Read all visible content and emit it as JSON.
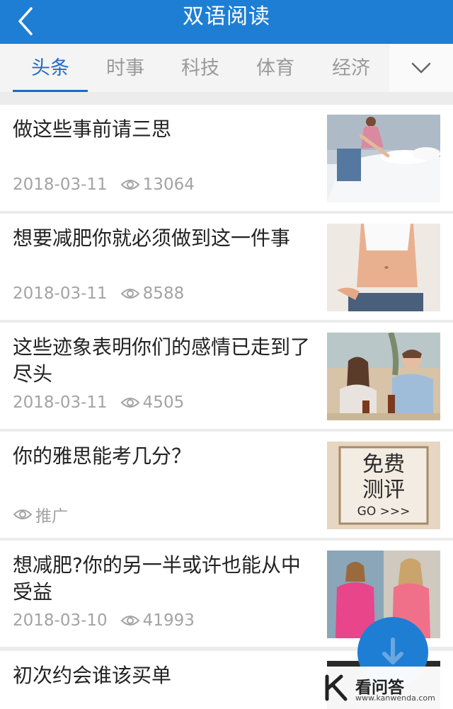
{
  "header": {
    "title": "双语阅读",
    "back_icon": "chevron-left-icon"
  },
  "tabs": [
    {
      "label": "头条",
      "active": true
    },
    {
      "label": "时事",
      "active": false
    },
    {
      "label": "科技",
      "active": false
    },
    {
      "label": "体育",
      "active": false
    },
    {
      "label": "经济",
      "active": false
    }
  ],
  "tabs_more_icon": "chevron-down-icon",
  "articles": [
    {
      "title": "做这些事前请三思",
      "date": "2018-03-11",
      "views": "13064",
      "thumb": "woman-making-bed"
    },
    {
      "title": "想要减肥你就必须做到这一件事",
      "date": "2018-03-11",
      "views": "8588",
      "thumb": "waist-jeans"
    },
    {
      "title": "这些迹象表明你们的感情已走到了尽头",
      "date": "2018-03-11",
      "views": "4505",
      "thumb": "couple-dining"
    },
    {
      "title": "你的雅思能考几分？",
      "date": "",
      "views": "推广",
      "thumb": "free-test-ad",
      "ad": {
        "line1": "免费",
        "line2": "测评",
        "line3": "GO >>>"
      }
    },
    {
      "title": "想减肥?你的另一半或许也能从中受益",
      "date": "2018-03-10",
      "views": "41993",
      "thumb": "two-women"
    },
    {
      "title": "初次约会谁该买单",
      "date": "",
      "views": "",
      "thumb": ""
    }
  ],
  "fab_icon": "arrow-down-icon",
  "watermark": {
    "text": "看问答",
    "url": "www.kanwenda.com"
  }
}
